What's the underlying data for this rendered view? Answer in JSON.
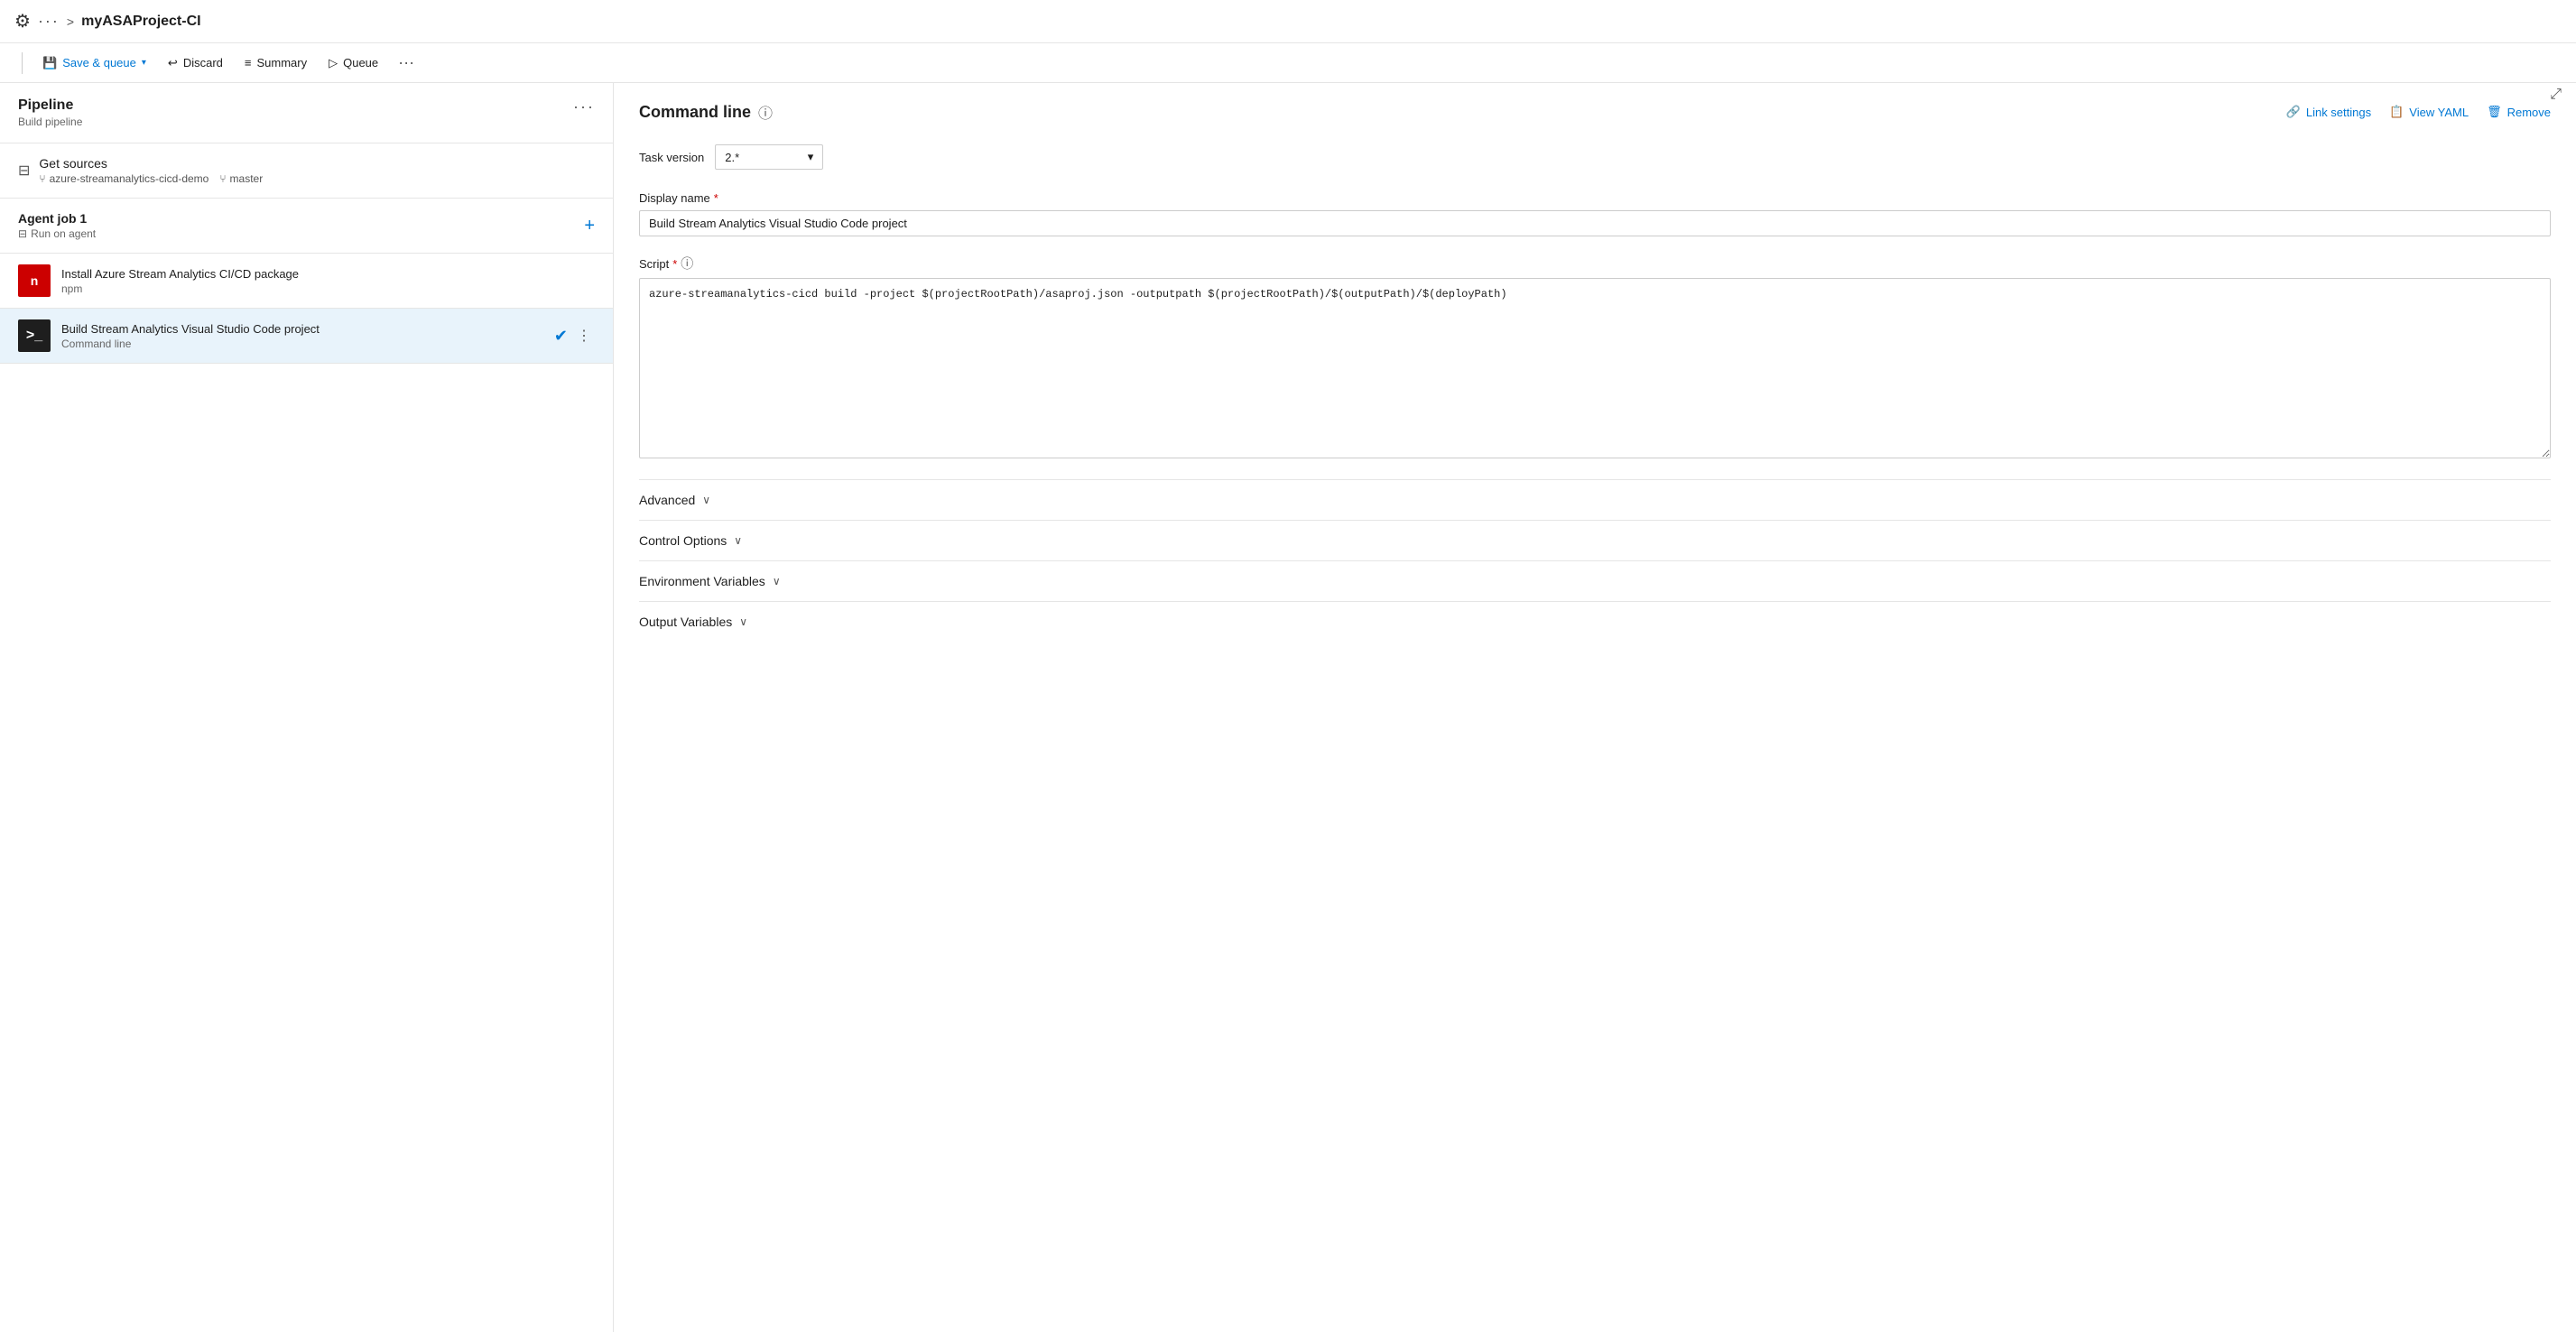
{
  "topbar": {
    "icon": "⚙",
    "dots": "···",
    "chevron": ">",
    "title": "myASAProject-CI"
  },
  "toolbar": {
    "save_queue_label": "Save & queue",
    "discard_label": "Discard",
    "summary_label": "Summary",
    "queue_label": "Queue",
    "more_dots": "···",
    "expand_icon": "⤢"
  },
  "left_panel": {
    "pipeline_title": "Pipeline",
    "pipeline_subtitle": "Build pipeline",
    "pipeline_dots": "···",
    "get_sources_title": "Get sources",
    "get_sources_repo": "azure-streamanalytics-cicd-demo",
    "get_sources_branch": "master",
    "agent_job_title": "Agent job 1",
    "agent_job_meta": "Run on agent",
    "tasks": [
      {
        "id": "install-task",
        "icon_type": "red",
        "icon_text": "n",
        "title": "Install Azure Stream Analytics CI/CD package",
        "subtitle": "npm",
        "active": false
      },
      {
        "id": "build-task",
        "icon_type": "terminal",
        "icon_text": ">_",
        "title": "Build Stream Analytics Visual Studio Code project",
        "subtitle": "Command line",
        "active": true
      }
    ]
  },
  "right_panel": {
    "cmd_title": "Command line",
    "task_version_label": "Task version",
    "task_version_value": "2.*",
    "link_settings_label": "Link settings",
    "view_yaml_label": "View YAML",
    "remove_label": "Remove",
    "display_name_label": "Display name",
    "display_name_required": "*",
    "display_name_value": "Build Stream Analytics Visual Studio Code project",
    "script_label": "Script",
    "script_required": "*",
    "script_value": "azure-streamanalytics-cicd build -project $(projectRootPath)/asaproj.json -outputpath $(projectRootPath)/$(outputPath)/$(deployPath)",
    "sections": [
      {
        "id": "advanced",
        "label": "Advanced"
      },
      {
        "id": "control-options",
        "label": "Control Options"
      },
      {
        "id": "environment-variables",
        "label": "Environment Variables"
      },
      {
        "id": "output-variables",
        "label": "Output Variables"
      }
    ]
  }
}
